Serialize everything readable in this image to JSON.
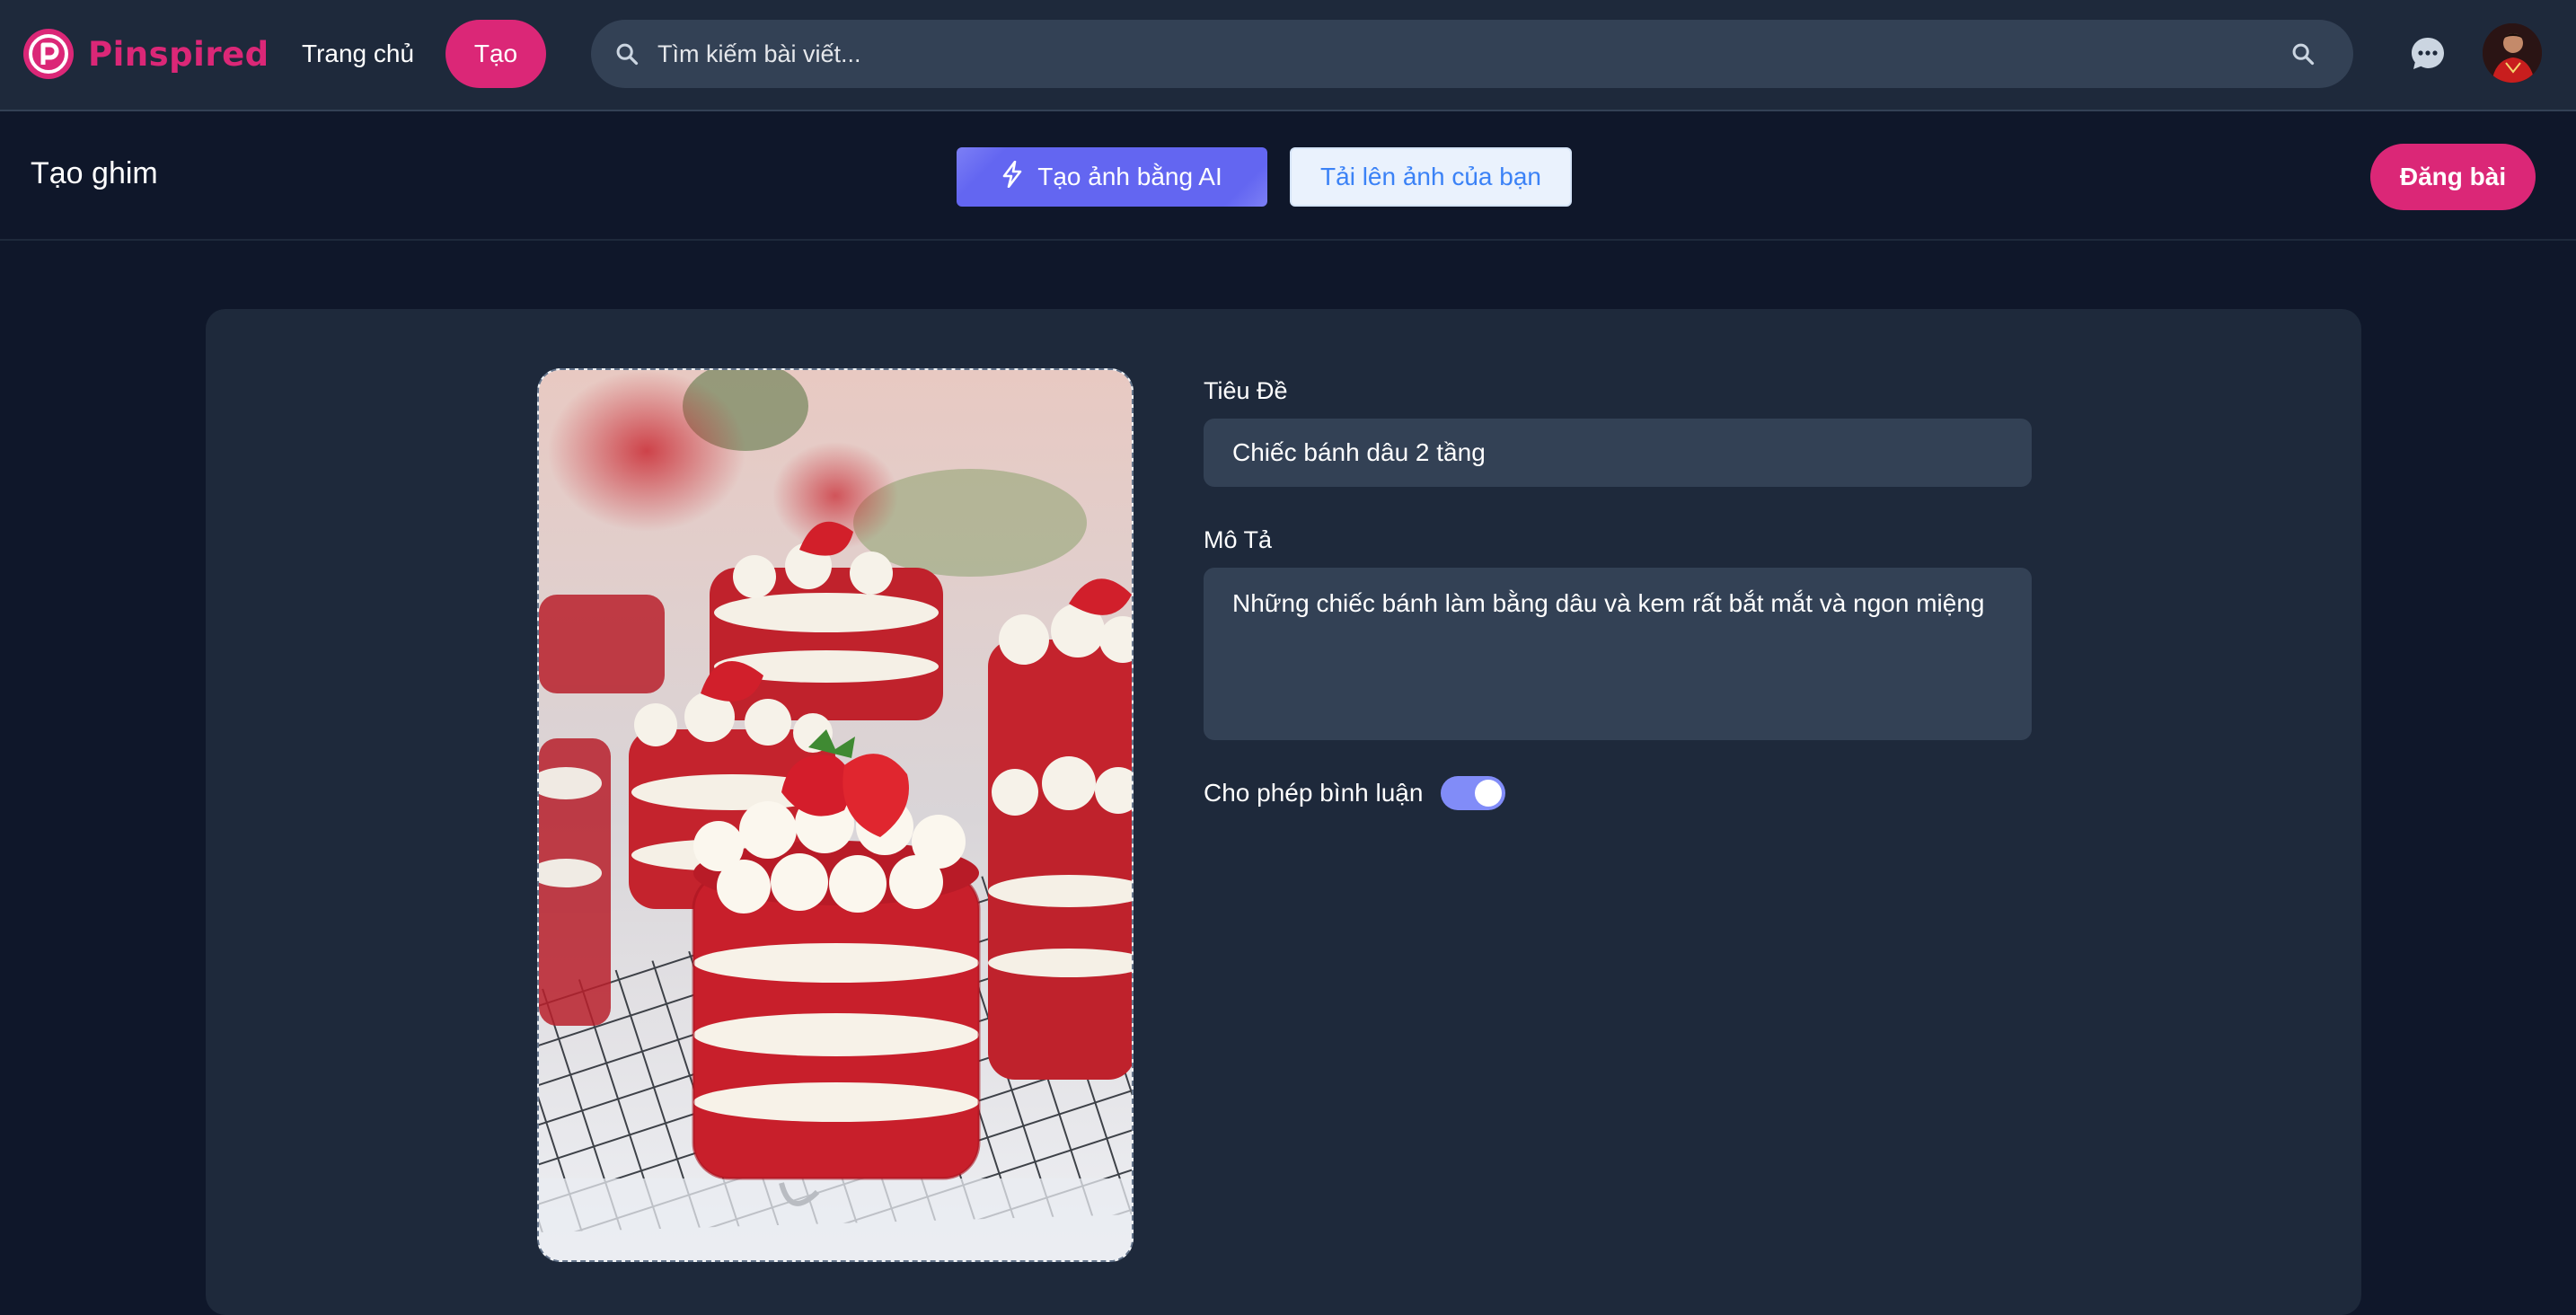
{
  "header": {
    "brand": "Pinspired",
    "nav": {
      "home": "Trang chủ",
      "create": "Tạo"
    },
    "search": {
      "placeholder": "Tìm kiếm bài viết..."
    },
    "icons": {
      "search": "search-icon",
      "messages": "message-icon",
      "avatar": "avatar"
    }
  },
  "subheader": {
    "title": "Tạo ghim",
    "ai_button": "Tạo ảnh bằng AI",
    "upload_button": "Tải lên ảnh của bạn",
    "post_button": "Đăng bài"
  },
  "form": {
    "title_label": "Tiêu Đề",
    "title_value": "Chiếc bánh dâu 2 tầng",
    "description_label": "Mô Tả",
    "description_value": "Những chiếc bánh làm bằng dâu và kem rất bắt mắt và ngon miệng",
    "allow_comments_label": "Cho phép bình luận",
    "allow_comments": true
  },
  "colors": {
    "brand": "#db2777",
    "ai_button": "#6366f1",
    "toggle": "#818cf8",
    "background": "#0f172a",
    "surface": "#1e293b",
    "input": "#334155"
  }
}
